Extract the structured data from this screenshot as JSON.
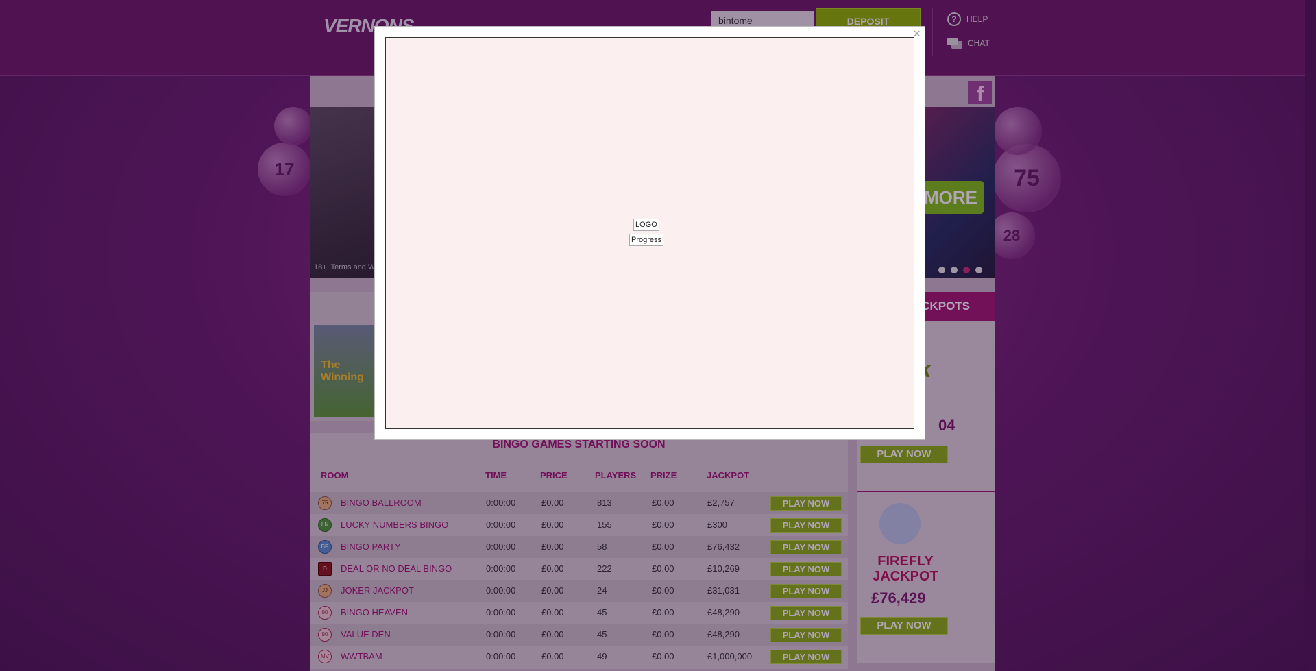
{
  "header": {
    "logo_text": "VERNONS",
    "username": "bintome",
    "deposit_label": "DEPOSIT",
    "help_label": "HELP",
    "chat_label": "CHAT"
  },
  "banner": {
    "terms_text": "18+. Terms and W",
    "more_label": "MORE",
    "balls": [
      "17",
      "75",
      "28"
    ]
  },
  "featured": {
    "thumb_text": "The Winning"
  },
  "jackpots": {
    "header": "CKPOTS",
    "items": [
      {
        "title": "alk",
        "amount": "04",
        "button": "PLAY NOW"
      },
      {
        "title": "FIREFLY JACKPOT",
        "amount": "£76,429",
        "button": "PLAY NOW"
      }
    ]
  },
  "bingo": {
    "title": "BINGO GAMES STARTING SOON",
    "columns": [
      "ROOM",
      "TIME",
      "PRICE",
      "PLAYERS",
      "PRIZE",
      "JACKPOT"
    ],
    "rows": [
      {
        "room": "BINGO BALLROOM",
        "time": "0:00:00",
        "price": "£0.00",
        "players": "813",
        "prize": "£0.00",
        "jackpot": "£2,757",
        "button": "PLAY NOW",
        "icon": "75"
      },
      {
        "room": "LUCKY NUMBERS BINGO",
        "time": "0:00:00",
        "price": "£0.00",
        "players": "155",
        "prize": "£0.00",
        "jackpot": "£300",
        "button": "PLAY NOW",
        "icon": "LN"
      },
      {
        "room": "BINGO PARTY",
        "time": "0:00:00",
        "price": "£0.00",
        "players": "58",
        "prize": "£0.00",
        "jackpot": "£76,432",
        "button": "PLAY NOW",
        "icon": "BP"
      },
      {
        "room": "DEAL OR NO DEAL BINGO",
        "time": "0:00:00",
        "price": "£0.00",
        "players": "222",
        "prize": "£0.00",
        "jackpot": "£10,269",
        "button": "PLAY NOW",
        "icon": "D"
      },
      {
        "room": "JOKER JACKPOT",
        "time": "0:00:00",
        "price": "£0.00",
        "players": "24",
        "prize": "£0.00",
        "jackpot": "£31,031",
        "button": "PLAY NOW",
        "icon": "JJ"
      },
      {
        "room": "BINGO HEAVEN",
        "time": "0:00:00",
        "price": "£0.00",
        "players": "45",
        "prize": "£0.00",
        "jackpot": "£48,290",
        "button": "PLAY NOW",
        "icon": "90"
      },
      {
        "room": "VALUE DEN",
        "time": "0:00:00",
        "price": "£0.00",
        "players": "45",
        "prize": "£0.00",
        "jackpot": "£48,290",
        "button": "PLAY NOW",
        "icon": "90"
      },
      {
        "room": "WWTBAM",
        "time": "0:00:00",
        "price": "£0.00",
        "players": "49",
        "prize": "£0.00",
        "jackpot": "£1,000,000",
        "button": "PLAY NOW",
        "icon": "MV"
      }
    ]
  },
  "modal": {
    "close_label": "×",
    "logo_alt": "LOGO",
    "progress_alt": "Progress"
  }
}
